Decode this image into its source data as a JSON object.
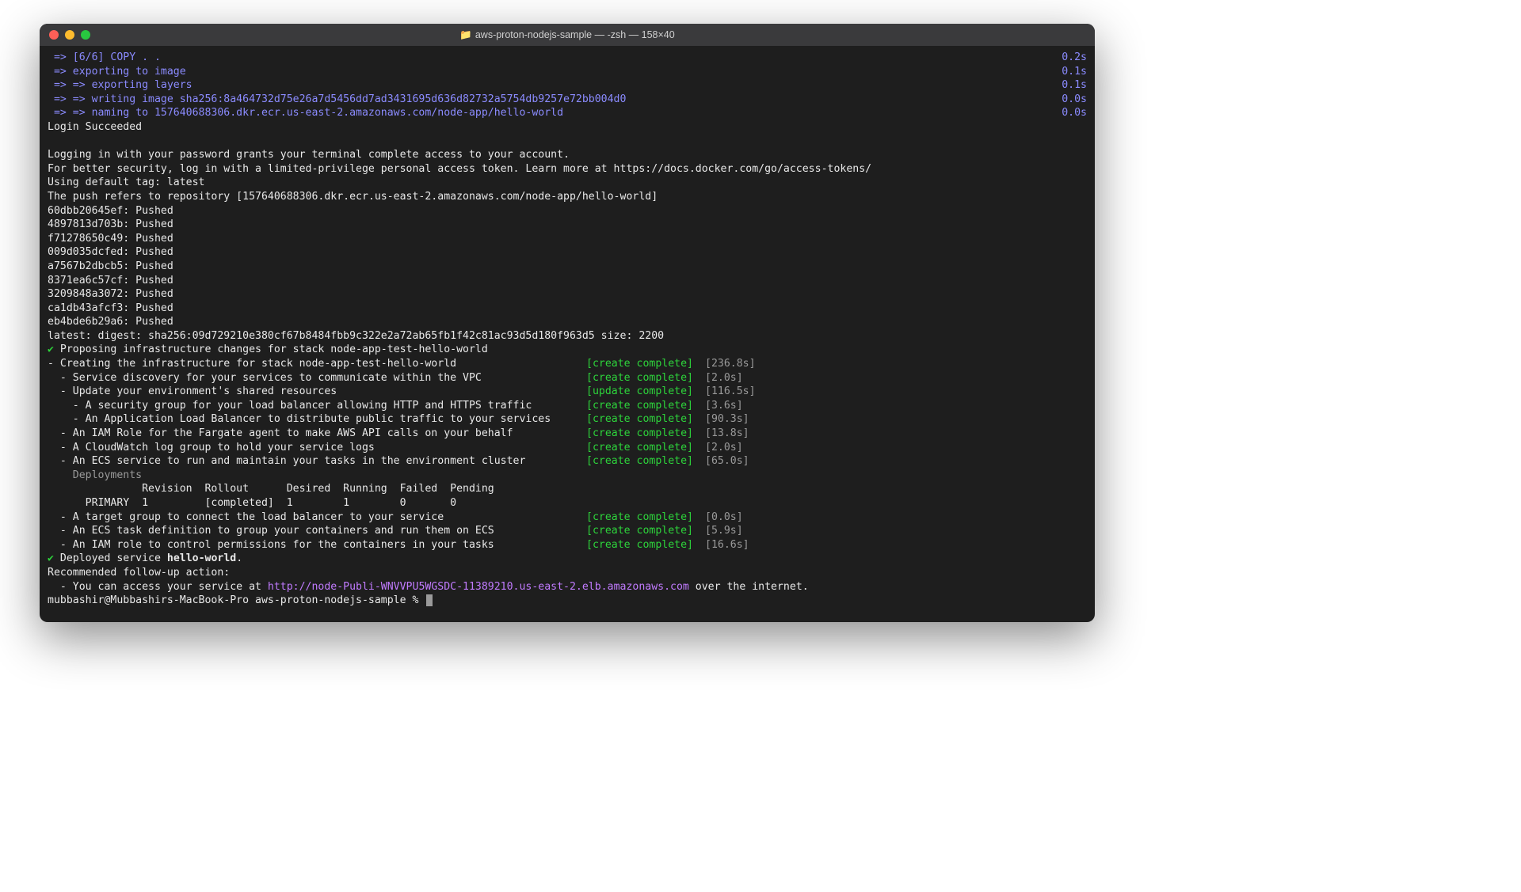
{
  "window": {
    "title_folder": "aws-proton-nodejs-sample",
    "title_suffix": " — -zsh — 158×40"
  },
  "build_lines": [
    {
      "left": " => [6/6] COPY . .",
      "right": "0.2s"
    },
    {
      "left": " => exporting to image",
      "right": "0.1s"
    },
    {
      "left": " => => exporting layers",
      "right": "0.1s"
    },
    {
      "left": " => => writing image sha256:8a464732d75e26a7d5456dd7ad3431695d636d82732a5754db9257e72bb004d0",
      "right": "0.0s"
    },
    {
      "left": " => => naming to 157640688306.dkr.ecr.us-east-2.amazonaws.com/node-app/hello-world",
      "right": "0.0s"
    }
  ],
  "plain_lines": [
    "Login Succeeded",
    "",
    "Logging in with your password grants your terminal complete access to your account.",
    "For better security, log in with a limited-privilege personal access token. Learn more at https://docs.docker.com/go/access-tokens/",
    "Using default tag: latest",
    "The push refers to repository [157640688306.dkr.ecr.us-east-2.amazonaws.com/node-app/hello-world]",
    "60dbb20645ef: Pushed",
    "4897813d703b: Pushed",
    "f71278650c49: Pushed",
    "009d035dcfed: Pushed",
    "a7567b2dbcb5: Pushed",
    "8371ea6c57cf: Pushed",
    "3209848a3072: Pushed",
    "ca1db43afcf3: Pushed",
    "eb4bde6b29a6: Pushed",
    "latest: digest: sha256:09d729210e380cf67b8484fbb9c322e2a72ab65fb1f42c81ac93d5d180f963d5 size: 2200"
  ],
  "propose_line": " Proposing infrastructure changes for stack node-app-test-hello-world",
  "infra": [
    {
      "desc": "- Creating the infrastructure for stack node-app-test-hello-world",
      "status": "[create complete]",
      "time": "[236.8s]"
    },
    {
      "desc": "  - Service discovery for your services to communicate within the VPC",
      "status": "[create complete]",
      "time": "[2.0s]"
    },
    {
      "desc": "  - Update your environment's shared resources",
      "status": "[update complete]",
      "time": "[116.5s]"
    },
    {
      "desc": "    - A security group for your load balancer allowing HTTP and HTTPS traffic",
      "status": "[create complete]",
      "time": "[3.6s]"
    },
    {
      "desc": "    - An Application Load Balancer to distribute public traffic to your services",
      "status": "[create complete]",
      "time": "[90.3s]"
    },
    {
      "desc": "  - An IAM Role for the Fargate agent to make AWS API calls on your behalf",
      "status": "[create complete]",
      "time": "[13.8s]"
    },
    {
      "desc": "  - A CloudWatch log group to hold your service logs",
      "status": "[create complete]",
      "time": "[2.0s]"
    },
    {
      "desc": "  - An ECS service to run and maintain your tasks in the environment cluster",
      "status": "[create complete]",
      "time": "[65.0s]"
    }
  ],
  "deployments_label": "    Deployments",
  "deployments_header": "               Revision  Rollout      Desired  Running  Failed  Pending",
  "deployments_row": "      PRIMARY  1         [completed]  1        1        0       0",
  "infra2": [
    {
      "desc": "  - A target group to connect the load balancer to your service",
      "status": "[create complete]",
      "time": "[0.0s]"
    },
    {
      "desc": "  - An ECS task definition to group your containers and run them on ECS",
      "status": "[create complete]",
      "time": "[5.9s]"
    },
    {
      "desc": "  - An IAM role to control permissions for the containers in your tasks",
      "status": "[create complete]",
      "time": "[16.6s]"
    }
  ],
  "deployed_prefix": " Deployed service ",
  "deployed_name": "hello-world",
  "deployed_suffix": ".",
  "recommended": "Recommended follow-up action:",
  "followup_prefix": "  - You can access your service at ",
  "followup_url": "http://node-Publi-WNVVPU5WGSDC-11389210.us-east-2.elb.amazonaws.com",
  "followup_suffix": " over the internet.",
  "prompt": "mubbashir@Mubbashirs-MacBook-Pro aws-proton-nodejs-sample % "
}
